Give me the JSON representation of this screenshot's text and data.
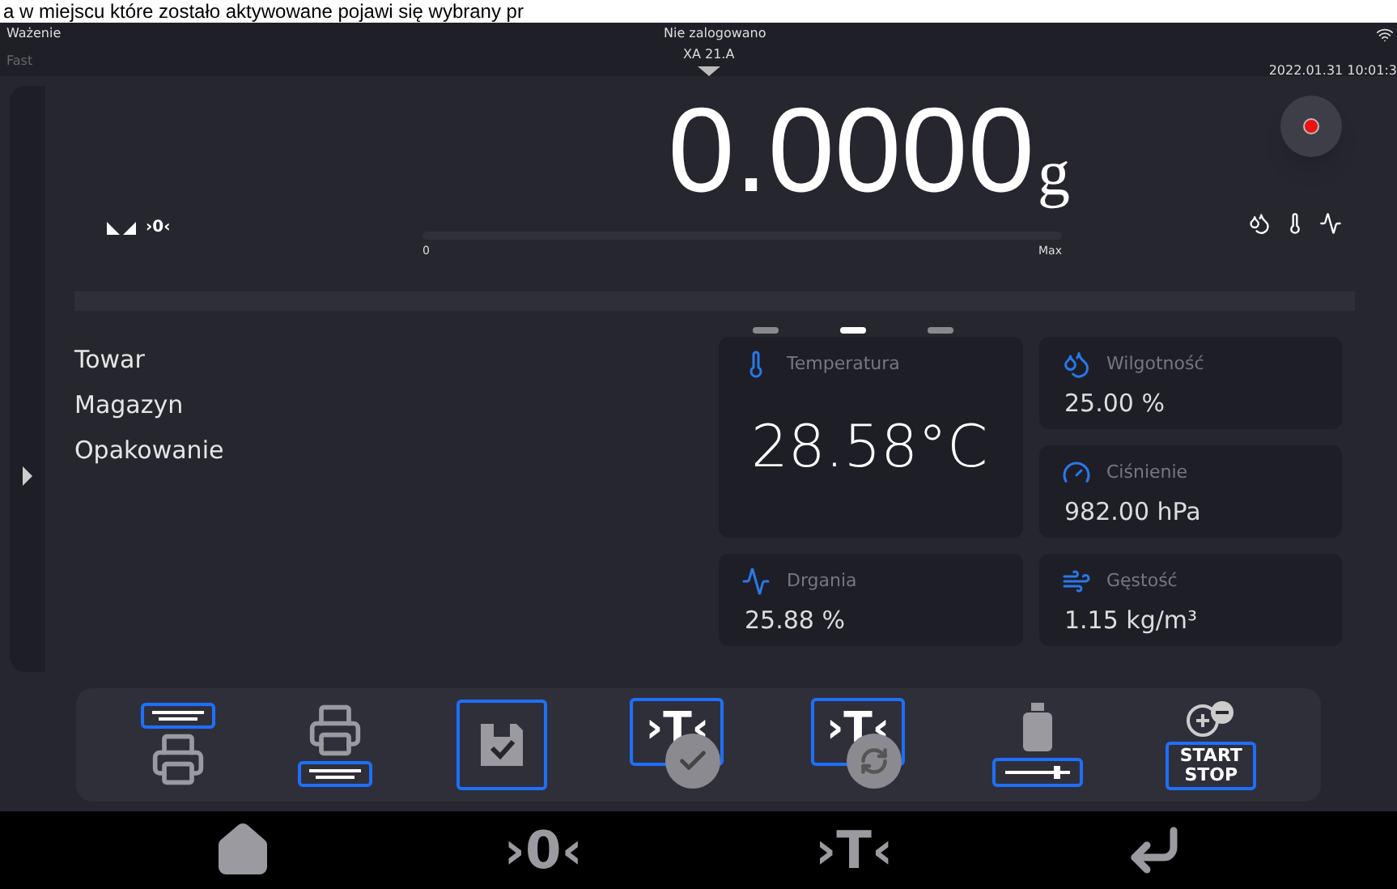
{
  "caption": "a w miejscu które zostało aktywowane pojawi się wybrany pr",
  "status_bar": {
    "mode": "Ważenie",
    "login": "Nie zalogowano",
    "speed": "Fast",
    "device": "XA 21.A",
    "datetime": "2022.01.31 10:01:3"
  },
  "weight": {
    "zero_mark": "›0‹",
    "value": "0.0000",
    "unit": "g",
    "scale_min": "0",
    "scale_max": "Max"
  },
  "pager": [
    {
      "selected": false
    },
    {
      "selected": true
    },
    {
      "selected": false
    }
  ],
  "info": [
    "Towar",
    "Magazyn",
    "Opakowanie"
  ],
  "widgets": [
    {
      "kind": "temperature",
      "label": "Temperatura",
      "value": "28.58°C"
    },
    {
      "kind": "humidity",
      "label": "Wilgotność",
      "value": "25.00 %"
    },
    {
      "kind": "pressure",
      "label": "Ciśnienie",
      "value": "982.00 hPa"
    },
    {
      "kind": "vibration",
      "label": "Drgania",
      "value": "25.88 %"
    },
    {
      "kind": "density",
      "label": "Gęstość",
      "value": "1.15 kg/m³"
    }
  ],
  "toolbar": [
    {
      "kind": "print_header"
    },
    {
      "kind": "print_footer"
    },
    {
      "kind": "save"
    },
    {
      "kind": "tare_confirm",
      "glyph": "›T‹"
    },
    {
      "kind": "tare_auto",
      "glyph": "›T‹"
    },
    {
      "kind": "weight_adjust"
    },
    {
      "kind": "start_stop",
      "top": "START",
      "bottom": "STOP"
    }
  ],
  "nav": [
    {
      "kind": "home"
    },
    {
      "kind": "zero",
      "glyph": "›0‹"
    },
    {
      "kind": "tare",
      "glyph": "›T‹"
    },
    {
      "kind": "enter"
    }
  ]
}
